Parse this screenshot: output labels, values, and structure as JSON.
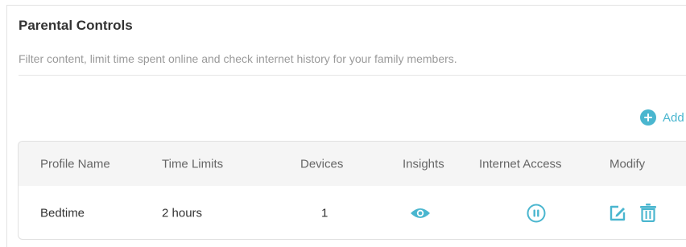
{
  "header": {
    "title": "Parental Controls",
    "subtitle": "Filter content, limit time spent online and check internet history for your family members."
  },
  "toolbar": {
    "add_label": "Add",
    "add_icon": "add-circle-icon"
  },
  "table": {
    "columns": [
      "Profile Name",
      "Time Limits",
      "Devices",
      "Insights",
      "Internet Access",
      "Modify"
    ],
    "rows": [
      {
        "profile_name": "Bedtime",
        "time_limits": "2 hours",
        "devices": "1",
        "insights_icon": "eye-icon",
        "internet_access_icon": "pause-icon",
        "modify_icons": [
          "edit-icon",
          "trash-icon"
        ]
      }
    ]
  },
  "colors": {
    "accent": "#4ab6cf",
    "header_bg": "#f5f5f5",
    "subtitle_text": "#9a9a9a",
    "border": "#e0e0e0"
  }
}
